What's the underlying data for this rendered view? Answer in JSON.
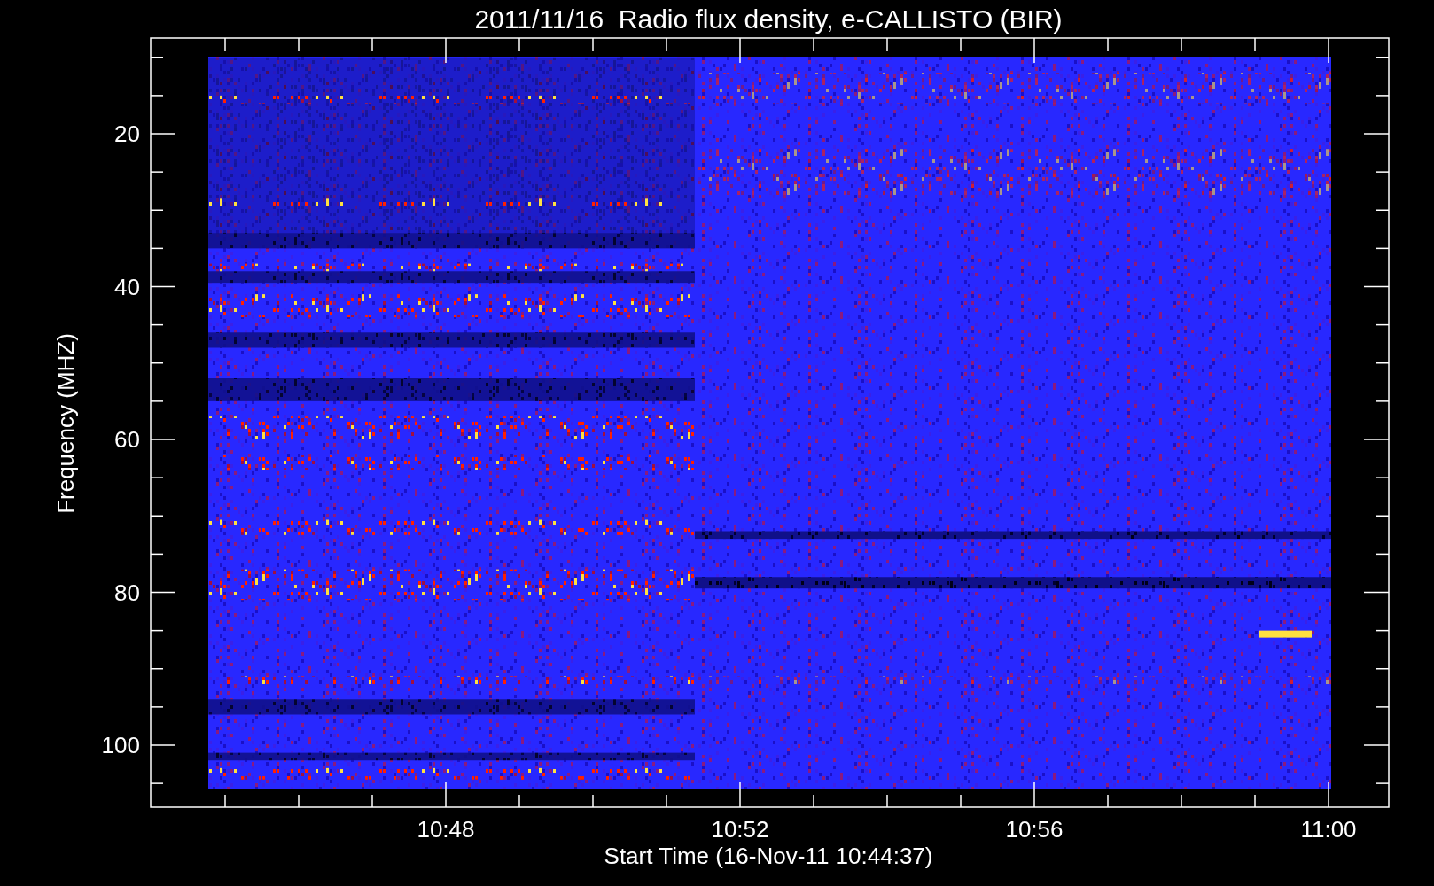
{
  "title": "2011/11/16  Radio flux density, e-CALLISTO (BIR)",
  "y_axis": {
    "label": "Frequency (MHZ)",
    "ticks": [
      "20",
      "40",
      "60",
      "80",
      "100"
    ]
  },
  "x_axis": {
    "label": "Start Time (16-Nov-11 10:44:37)",
    "ticks": [
      "10:48",
      "10:52",
      "10:56",
      "11:00"
    ]
  }
}
